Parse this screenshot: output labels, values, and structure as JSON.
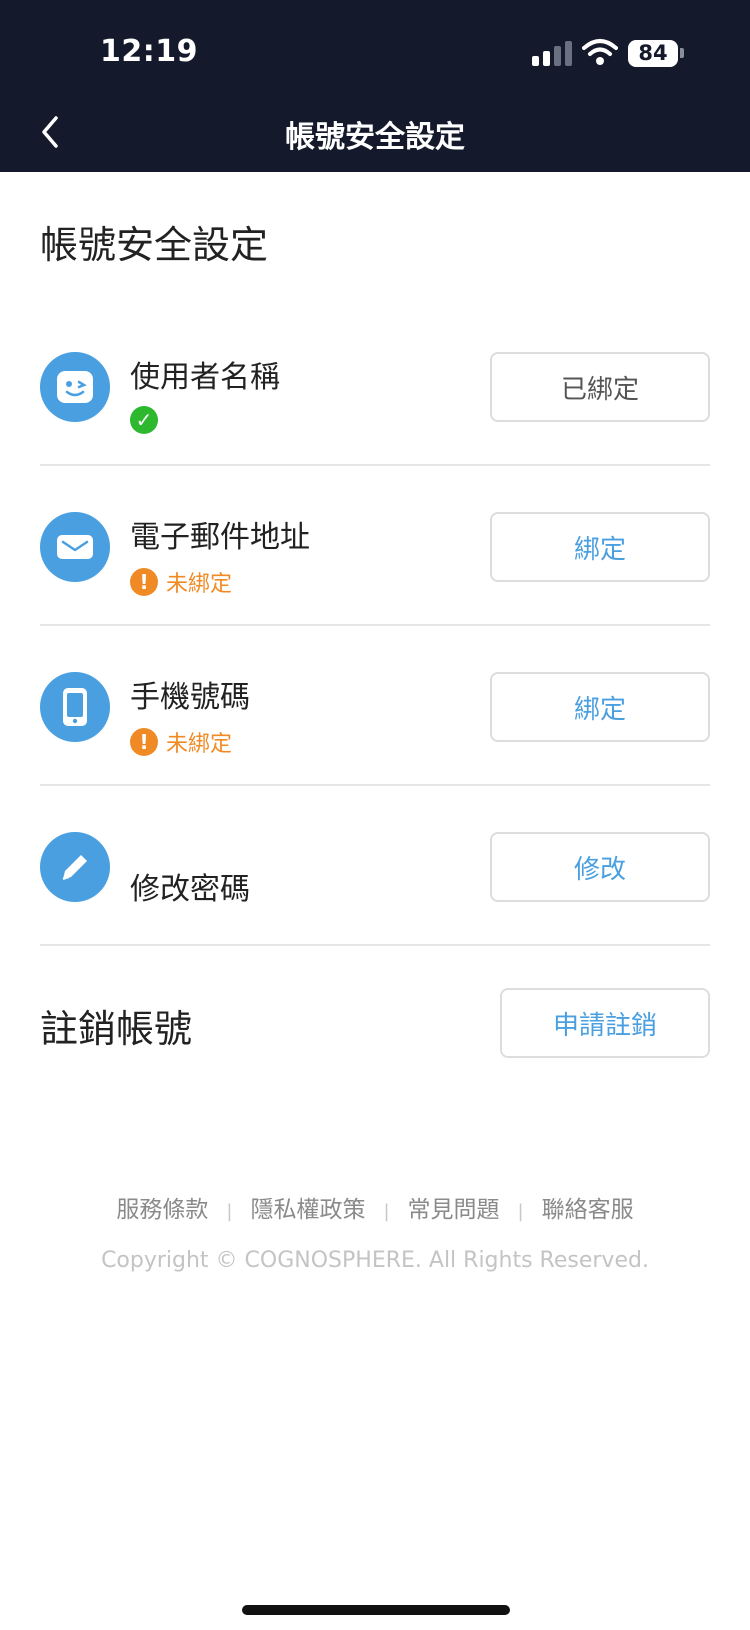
{
  "status_bar": {
    "time": "12:19",
    "battery": "84"
  },
  "nav": {
    "title": "帳號安全設定"
  },
  "page": {
    "section_title": "帳號安全設定"
  },
  "rows": [
    {
      "label": "使用者名稱",
      "status": "",
      "status_type": "ok",
      "button": "已綁定"
    },
    {
      "label": "電子郵件地址",
      "status": "未綁定",
      "status_type": "warn",
      "button": "綁定"
    },
    {
      "label": "手機號碼",
      "status": "未綁定",
      "status_type": "warn",
      "button": "綁定"
    },
    {
      "label": "修改密碼",
      "button": "修改"
    }
  ],
  "cancel": {
    "label": "註銷帳號",
    "button": "申請註銷"
  },
  "footer": {
    "links": [
      "服務條款",
      "隱私權政策",
      "常見問題",
      "聯絡客服"
    ],
    "copyright": "Copyright © COGNOSPHERE. All Rights Reserved."
  },
  "colors": {
    "accent": "#4a9fe0",
    "warning": "#f08a24",
    "success": "#2db82d",
    "header_bg": "#141a2c"
  },
  "icons": {
    "row_0": "smiley-face-icon",
    "row_1": "envelope-icon",
    "row_2": "phone-icon",
    "row_3": "pencil-icon"
  }
}
